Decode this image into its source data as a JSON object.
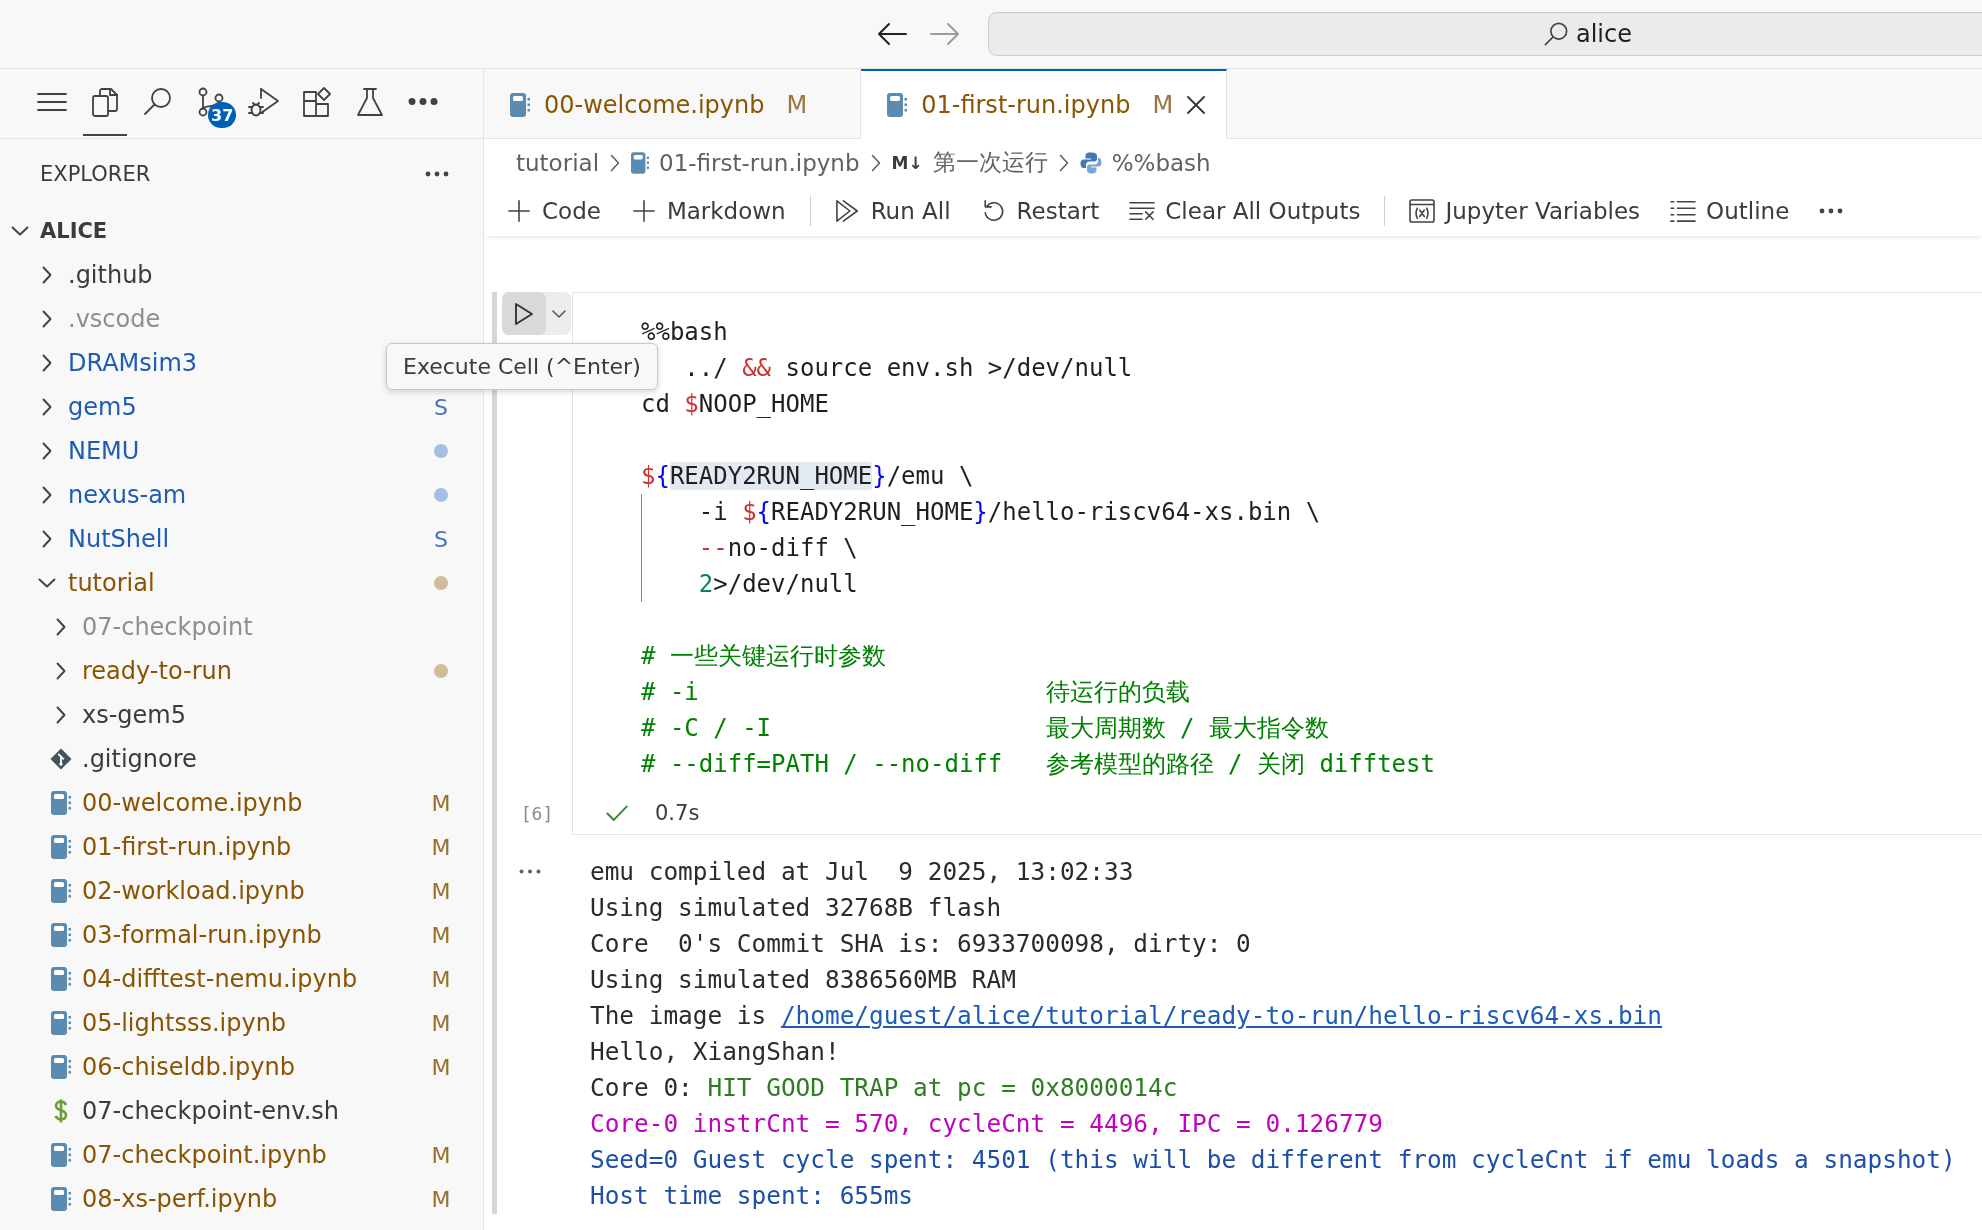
{
  "navigation": {
    "back": {
      "disabled": false
    },
    "forward": {
      "disabled": true
    }
  },
  "command_center": {
    "label": "alice"
  },
  "activity_bar": {
    "items": [
      {
        "kind": "menu",
        "selected": false
      },
      {
        "kind": "explorer",
        "selected": true
      },
      {
        "kind": "search",
        "selected": false
      },
      {
        "kind": "source-control",
        "selected": false,
        "badge": "37"
      },
      {
        "kind": "run-debug",
        "selected": false
      },
      {
        "kind": "extensions",
        "selected": false
      },
      {
        "kind": "testing",
        "selected": false
      },
      {
        "kind": "more",
        "selected": false
      }
    ]
  },
  "explorer": {
    "title": "EXPLORER",
    "root": {
      "label": "ALICE",
      "expanded": true,
      "children": [
        {
          "label": ".github",
          "kind": "folder",
          "expanded": false,
          "color": "#3b3b3b",
          "dot": false
        },
        {
          "label": ".vscode",
          "kind": "folder",
          "expanded": false,
          "color": "#8e8e8e",
          "dot": false
        },
        {
          "label": "DRAMsim3",
          "kind": "folder",
          "expanded": false,
          "color": "#1f5cb4",
          "dot": false
        },
        {
          "label": "gem5",
          "kind": "folder",
          "expanded": false,
          "color": "#1f5cb4",
          "dot": false,
          "badge": "S"
        },
        {
          "label": "NEMU",
          "kind": "folder",
          "expanded": false,
          "color": "#1f5cb4",
          "dot": true
        },
        {
          "label": "nexus-am",
          "kind": "folder",
          "expanded": false,
          "color": "#1f5cb4",
          "dot": true
        },
        {
          "label": "NutShell",
          "kind": "folder",
          "expanded": false,
          "color": "#1f5cb4",
          "dot": false,
          "badge": "S"
        },
        {
          "label": "tutorial",
          "kind": "folder",
          "expanded": true,
          "color": "#895503",
          "dot": true,
          "children": [
            {
              "label": "07-checkpoint",
              "kind": "folder",
              "expanded": false,
              "color": "#8e8e8e",
              "dot": false
            },
            {
              "label": "ready-to-run",
              "kind": "folder",
              "expanded": false,
              "color": "#895503",
              "dot": true
            },
            {
              "label": "xs-gem5",
              "kind": "folder",
              "expanded": false,
              "color": "#3b3b3b",
              "dot": false
            },
            {
              "label": ".gitignore",
              "kind": "gitignore",
              "color": "#3b3b3b",
              "dot": false
            },
            {
              "label": "00-welcome.ipynb",
              "kind": "notebook",
              "color": "#895503",
              "dot": false,
              "badge": "M"
            },
            {
              "label": "01-first-run.ipynb",
              "kind": "notebook",
              "color": "#895503",
              "dot": false,
              "badge": "M"
            },
            {
              "label": "02-workload.ipynb",
              "kind": "notebook",
              "color": "#895503",
              "dot": false,
              "badge": "M"
            },
            {
              "label": "03-formal-run.ipynb",
              "kind": "notebook",
              "color": "#895503",
              "dot": false,
              "badge": "M"
            },
            {
              "label": "04-difftest-nemu.ipynb",
              "kind": "notebook",
              "color": "#895503",
              "dot": false,
              "badge": "M"
            },
            {
              "label": "05-lightsss.ipynb",
              "kind": "notebook",
              "color": "#895503",
              "dot": false,
              "badge": "M"
            },
            {
              "label": "06-chiseldb.ipynb",
              "kind": "notebook",
              "color": "#895503",
              "dot": false,
              "badge": "M"
            },
            {
              "label": "07-checkpoint-env.sh",
              "kind": "shell",
              "color": "#3b3b3b",
              "dot": false
            },
            {
              "label": "07-checkpoint.ipynb",
              "kind": "notebook",
              "color": "#895503",
              "dot": false,
              "badge": "M"
            },
            {
              "label": "08-xs-perf.ipynb",
              "kind": "notebook",
              "color": "#895503",
              "dot": false,
              "badge": "M"
            }
          ]
        }
      ]
    }
  },
  "tabs": [
    {
      "label": "00-welcome.ipynb",
      "badge": "M",
      "selected": false
    },
    {
      "label": "01-first-run.ipynb",
      "badge": "M",
      "selected": true
    }
  ],
  "breadcrumbs": [
    {
      "kind": "folder",
      "label": "tutorial"
    },
    {
      "kind": "notebook",
      "label": "01-first-run.ipynb"
    },
    {
      "kind": "markdown",
      "marker": "M↓",
      "label": "第一次运行"
    },
    {
      "kind": "code",
      "label": "%%bash"
    }
  ],
  "notebook_toolbar": {
    "groups": [
      {
        "items": [
          {
            "kind": "add",
            "label": "Code"
          },
          {
            "kind": "add",
            "label": "Markdown"
          }
        ]
      },
      {
        "items": [
          {
            "kind": "run-all",
            "label": "Run All"
          },
          {
            "kind": "restart",
            "label": "Restart"
          },
          {
            "kind": "clear-outputs",
            "label": "Clear All Outputs"
          }
        ]
      },
      {
        "items": [
          {
            "kind": "variables",
            "label": "Jupyter Variables"
          },
          {
            "kind": "outline",
            "label": "Outline"
          }
        ]
      }
    ]
  },
  "cell": {
    "tooltip": "Execute Cell (^Enter)",
    "lines": [
      {
        "guide": false,
        "tokens": [
          {
            "text": "%%bash",
            "kind": "plain"
          }
        ]
      },
      {
        "guide": false,
        "tokens": [
          {
            "text": "   ../ ",
            "kind": "plain"
          },
          {
            "text": "&&",
            "kind": "operator"
          },
          {
            "text": " source env.sh >/dev/null",
            "kind": "plain"
          }
        ]
      },
      {
        "guide": false,
        "tokens": [
          {
            "text": "cd ",
            "kind": "plain"
          },
          {
            "text": "$",
            "kind": "operator"
          },
          {
            "text": "NOOP_HOME",
            "kind": "plain"
          }
        ]
      },
      {
        "guide": false
      },
      {
        "guide": false,
        "tokens": [
          {
            "text": "$",
            "kind": "operator"
          },
          {
            "text": "{",
            "kind": "brace"
          },
          {
            "text": "READY2RUN_HOME",
            "kind": "highlight"
          },
          {
            "text": "}",
            "kind": "brace"
          },
          {
            "text": "/emu \\",
            "kind": "plain"
          }
        ]
      },
      {
        "guide": true,
        "tokens": [
          {
            "text": "-i ",
            "kind": "plain"
          },
          {
            "text": "$",
            "kind": "operator"
          },
          {
            "text": "{",
            "kind": "brace"
          },
          {
            "text": "READY2RUN_HOME",
            "kind": "plain"
          },
          {
            "text": "}",
            "kind": "brace"
          },
          {
            "text": "/hello-riscv64-xs.bin \\",
            "kind": "plain"
          }
        ]
      },
      {
        "guide": true,
        "tokens": [
          {
            "text": "--",
            "kind": "operator"
          },
          {
            "text": "no-diff \\",
            "kind": "plain"
          }
        ]
      },
      {
        "guide": true,
        "tokens": [
          {
            "text": "2",
            "kind": "number"
          },
          {
            "text": ">/dev/null",
            "kind": "plain"
          }
        ]
      },
      {
        "guide": false
      },
      {
        "guide": false,
        "tokens": [
          {
            "text": "# 一些关键运行时参数",
            "kind": "comment"
          }
        ]
      },
      {
        "guide": false,
        "tokens": [
          {
            "text": "# -i                        待运行的负载",
            "kind": "comment"
          }
        ]
      },
      {
        "guide": false,
        "tokens": [
          {
            "text": "# -C / -I                   最大周期数 / 最大指令数",
            "kind": "comment"
          }
        ]
      },
      {
        "guide": false,
        "tokens": [
          {
            "text": "# --diff=PATH / --no-diff   参考模型的路径 / 关闭 difftest",
            "kind": "comment"
          }
        ]
      }
    ],
    "execution_count": "[6]",
    "status": {
      "success": true,
      "time": "0.7s"
    },
    "output": [
      {
        "segments": [
          {
            "text": "emu compiled at Jul  9 2025, 13:02:33",
            "kind": "plain"
          }
        ]
      },
      {
        "segments": [
          {
            "text": "Using simulated 32768B flash",
            "kind": "plain"
          }
        ]
      },
      {
        "segments": [
          {
            "text": "Core  0's Commit SHA is: 6933700098, dirty: 0",
            "kind": "plain"
          }
        ]
      },
      {
        "segments": [
          {
            "text": "Using simulated 8386560MB RAM",
            "kind": "plain"
          }
        ]
      },
      {
        "segments": [
          {
            "text": "The image is ",
            "kind": "plain"
          },
          {
            "text": "/home/guest/alice/tutorial/ready-to-run/hello-riscv64-xs.bin",
            "kind": "link"
          }
        ]
      },
      {
        "segments": [
          {
            "text": "Hello, XiangShan!",
            "kind": "plain"
          }
        ]
      },
      {
        "segments": [
          {
            "text": "Core 0: ",
            "kind": "plain"
          },
          {
            "text": "HIT GOOD TRAP at pc = 0x8000014c",
            "kind": "success"
          }
        ]
      },
      {
        "segments": [
          {
            "text": "Core-0 instrCnt = 570, cycleCnt = 4496, IPC = 0.126779",
            "kind": "magenta"
          }
        ]
      },
      {
        "segments": [
          {
            "text": "Seed=0 Guest cycle spent: 4501 (this will be different from cycleCnt if emu loads a snapshot)",
            "kind": "info"
          }
        ]
      },
      {
        "segments": [
          {
            "text": "Host time spent: 655ms",
            "kind": "info"
          }
        ]
      }
    ]
  }
}
